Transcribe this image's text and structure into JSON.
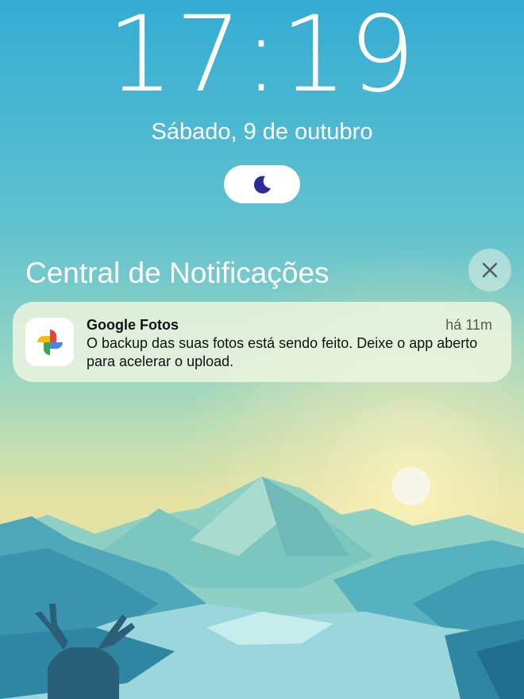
{
  "lock_screen": {
    "time": "17:19",
    "date": "Sábado, 9 de outubro",
    "focus_icon": "moon-icon",
    "colors": {
      "sky_top": "#3aaed3",
      "sky_bottom": "#f2e4a0",
      "focus_moon": "#2c2c9c"
    }
  },
  "notification_center": {
    "title": "Central de Notificações",
    "close_icon": "close-icon"
  },
  "notification": {
    "app_name": "Google Fotos",
    "time": "há 11m",
    "body": "O backup das suas fotos está sendo feito. Deixe o app aberto para acelerar o upload.",
    "icon": "google-photos-icon"
  }
}
